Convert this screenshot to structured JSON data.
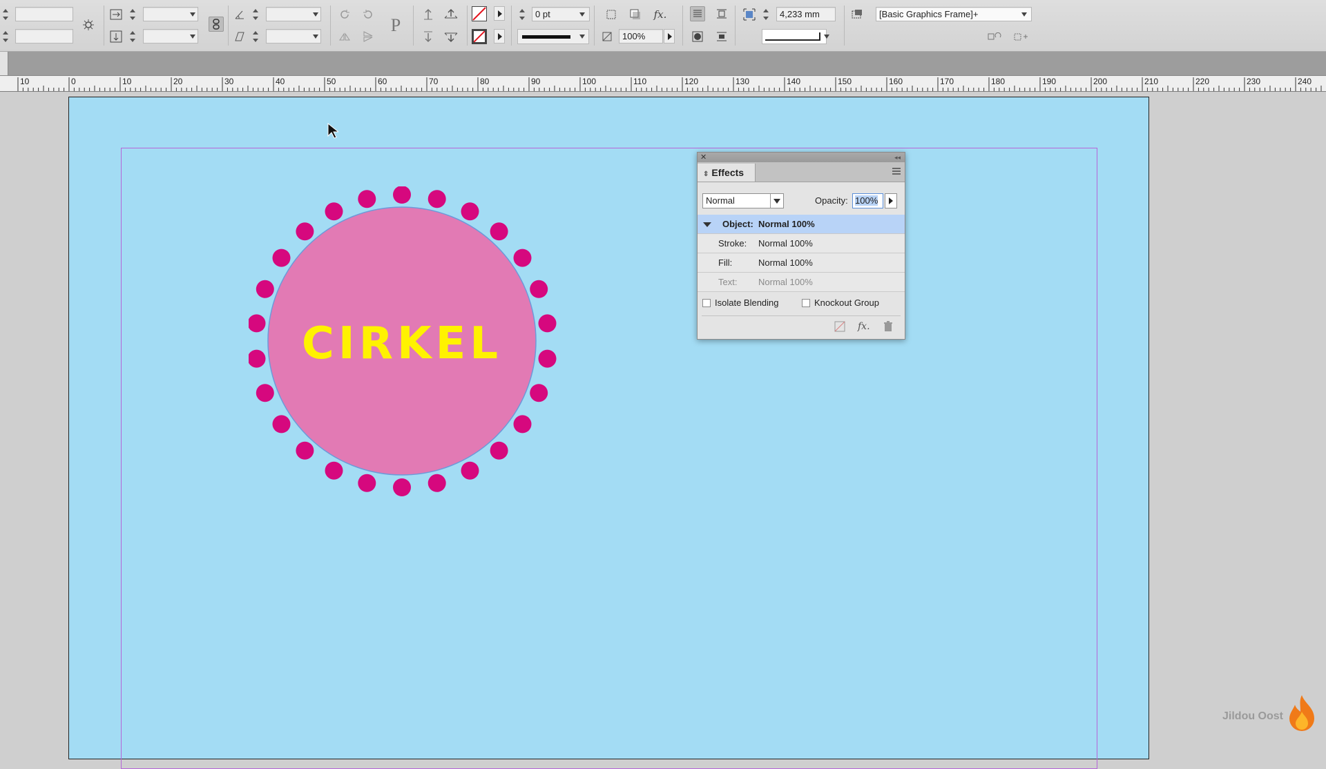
{
  "control_bar": {
    "stroke_weight": "0 pt",
    "scale_percent": "100%",
    "dimension_value": "4,233 mm",
    "object_style": "[Basic Graphics Frame]+"
  },
  "ruler": {
    "labels": [
      "10",
      "0",
      "10",
      "20",
      "30",
      "40",
      "50",
      "60",
      "70",
      "80",
      "90",
      "100",
      "110",
      "120",
      "130",
      "140",
      "150",
      "160",
      "170",
      "180",
      "190",
      "200",
      "210",
      "220",
      "230",
      "240"
    ]
  },
  "artwork": {
    "text": "CIRKEL",
    "colors": {
      "circle": "#e27ab4",
      "dots": "#d6087e",
      "text": "#fff200",
      "page": "#a3dcf4",
      "margin_guide": "#b565d8"
    }
  },
  "effects_panel": {
    "title": "Effects",
    "blend_mode": "Normal",
    "opacity_label": "Opacity:",
    "opacity_value": "100%",
    "rows": [
      {
        "label": "Object:",
        "value": "Normal 100%"
      },
      {
        "label": "Stroke:",
        "value": "Normal 100%"
      },
      {
        "label": "Fill:",
        "value": "Normal 100%"
      },
      {
        "label": "Text:",
        "value": "Normal 100%"
      }
    ],
    "isolate_blending_label": "Isolate Blending",
    "knockout_group_label": "Knockout Group",
    "icons": [
      "clear-effects-icon",
      "fx-icon",
      "trash-icon"
    ]
  },
  "watermark": "Jildou Oost"
}
